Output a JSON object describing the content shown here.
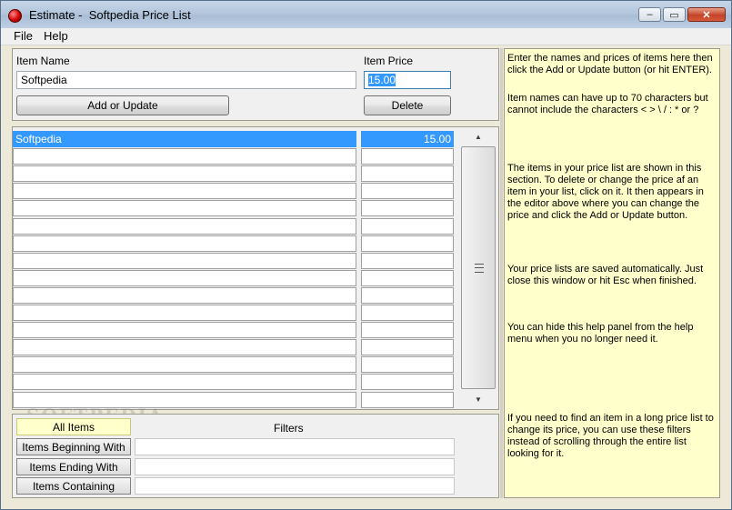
{
  "window": {
    "title": "Estimate -  Softpedia Price List",
    "minimize_label": "–",
    "maximize_label": "▭",
    "close_label": "✕"
  },
  "menu": {
    "file": "File",
    "help": "Help"
  },
  "editor": {
    "item_name_label": "Item Name",
    "item_name_value": "Softpedia",
    "item_price_label": "Item Price",
    "item_price_value": "15.00",
    "add_update_label": "Add or Update",
    "delete_label": "Delete"
  },
  "list": {
    "items": [
      {
        "name": "Softpedia",
        "price": "15.00"
      },
      {
        "name": "",
        "price": ""
      },
      {
        "name": "",
        "price": ""
      },
      {
        "name": "",
        "price": ""
      },
      {
        "name": "",
        "price": ""
      },
      {
        "name": "",
        "price": ""
      },
      {
        "name": "",
        "price": ""
      },
      {
        "name": "",
        "price": ""
      },
      {
        "name": "",
        "price": ""
      },
      {
        "name": "",
        "price": ""
      },
      {
        "name": "",
        "price": ""
      },
      {
        "name": "",
        "price": ""
      },
      {
        "name": "",
        "price": ""
      },
      {
        "name": "",
        "price": ""
      },
      {
        "name": "",
        "price": ""
      },
      {
        "name": "",
        "price": ""
      }
    ],
    "scroll_up": "▲",
    "scroll_down": "▼"
  },
  "filters": {
    "title": "Filters",
    "all_items": "All Items",
    "beginning_with": "Items Beginning With",
    "ending_with": "Items Ending With",
    "containing": "Items Containing"
  },
  "help": [
    "Enter the names and prices of items here then click the Add or Update button (or hit ENTER).",
    "Item names can have up to 70 characters but cannot include the characters < > \\ / : * or ?",
    "The items in your price list are shown in this section.  To delete or change the price af an item in your list, click on it.   It then appears in the editor above where you can change the price and click the Add or Update button.",
    "Your price lists are saved automatically.   Just close this window or hit Esc when finished.",
    "You can hide this help panel from the help menu when you no longer need it.",
    "If you need to find an item in a long price list to change its price, you can use these filters instead of scrolling through the entire list looking for it."
  ],
  "watermark": "SOFTPEDIA"
}
